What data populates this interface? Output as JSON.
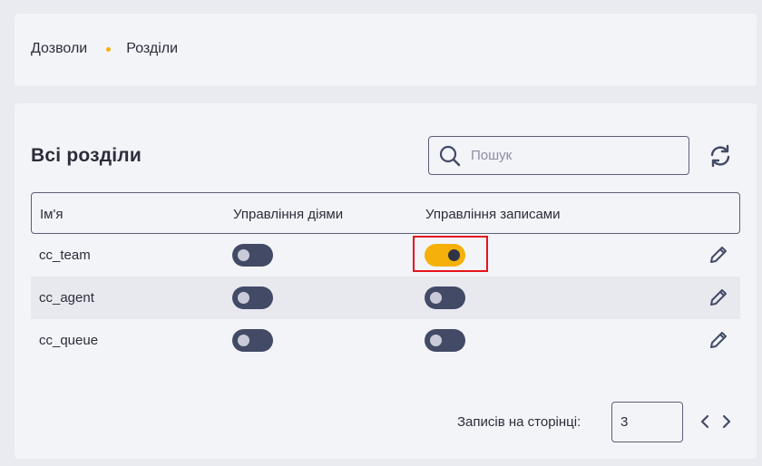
{
  "breadcrumb": {
    "items": [
      "Дозволи",
      "Розділи"
    ]
  },
  "section": {
    "title": "Всі розділи"
  },
  "search": {
    "placeholder": "Пошук"
  },
  "table": {
    "headers": [
      "Ім'я",
      "Управління діями",
      "Управління записами"
    ],
    "rows": [
      {
        "name": "cc_team",
        "actions_enabled": false,
        "records_enabled": true
      },
      {
        "name": "cc_agent",
        "actions_enabled": false,
        "records_enabled": false
      },
      {
        "name": "cc_queue",
        "actions_enabled": false,
        "records_enabled": false
      }
    ]
  },
  "pagination": {
    "label": "Записів на сторінці:",
    "per_page": "3"
  },
  "colors": {
    "accent": "#f5b10a",
    "toggle_off": "#434a66",
    "highlight": "#e8121b"
  },
  "icons": {
    "search": "search-icon",
    "refresh": "refresh-icon",
    "edit": "pencil-icon",
    "prev": "chevron-left-icon",
    "next": "chevron-right-icon"
  }
}
